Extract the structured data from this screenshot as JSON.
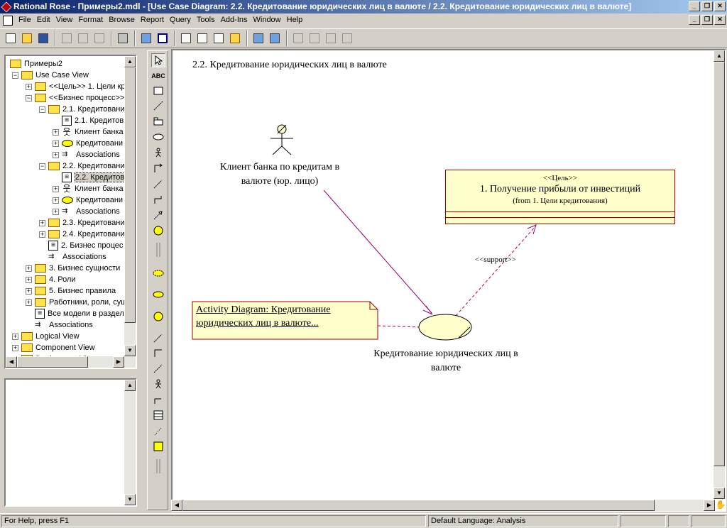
{
  "window": {
    "title": "Rational Rose - Примеры2.mdl - [Use Case Diagram: 2.2. Кредитование юридических лиц в валюте / 2.2. Кредитование юридических лиц в валюте]",
    "minimize": "_",
    "restore": "❐",
    "close": "✕"
  },
  "menu": [
    "File",
    "Edit",
    "View",
    "Format",
    "Browse",
    "Report",
    "Query",
    "Tools",
    "Add-Ins",
    "Window",
    "Help"
  ],
  "toolbar_icons": [
    "new-icon",
    "open-icon",
    "save-icon",
    "cut-icon",
    "copy-icon",
    "paste-icon",
    "print-icon",
    "context-help-icon",
    "view-documentation-icon",
    "browse-class-diagram-icon",
    "browse-interaction-diagram-icon",
    "browse-component-diagram-icon",
    "browse-deployment-diagram-icon",
    "browse-parent-icon",
    "browse-previous-icon",
    "zoom-in-icon",
    "zoom-out-icon",
    "fit-in-window-icon",
    "undo-fit-icon"
  ],
  "browser": {
    "items": [
      {
        "label": "Примеры2",
        "depth": 0,
        "icon": "model",
        "exp": ""
      },
      {
        "label": "Use Case View",
        "depth": 1,
        "icon": "folder",
        "exp": "−"
      },
      {
        "label": "<<Цель>> 1. Цели кр",
        "depth": 2,
        "icon": "folder",
        "exp": "+"
      },
      {
        "label": "<<Бизнес процесс>>",
        "depth": 2,
        "icon": "folder",
        "exp": "−"
      },
      {
        "label": "2.1. Кредитовани",
        "depth": 3,
        "icon": "folder",
        "exp": "−"
      },
      {
        "label": "2.1. Кредитов",
        "depth": 4,
        "icon": "diagram",
        "exp": ""
      },
      {
        "label": "Клиент банка",
        "depth": 4,
        "icon": "actor",
        "exp": "+"
      },
      {
        "label": "Кредитовани",
        "depth": 4,
        "icon": "usecase",
        "exp": "+"
      },
      {
        "label": "Associations",
        "depth": 4,
        "icon": "assoc",
        "exp": "+"
      },
      {
        "label": "2.2. Кредитовани",
        "depth": 3,
        "icon": "folder",
        "exp": "−"
      },
      {
        "label": "2.2. Кредитов",
        "depth": 4,
        "icon": "diagram",
        "exp": "",
        "selected": true
      },
      {
        "label": "Клиент банка",
        "depth": 4,
        "icon": "actor",
        "exp": "+"
      },
      {
        "label": "Кредитовани",
        "depth": 4,
        "icon": "usecase",
        "exp": "+"
      },
      {
        "label": "Associations",
        "depth": 4,
        "icon": "assoc",
        "exp": "+"
      },
      {
        "label": "2.3. Кредитовани",
        "depth": 3,
        "icon": "folder",
        "exp": "+"
      },
      {
        "label": "2.4. Кредитовани",
        "depth": 3,
        "icon": "folder",
        "exp": "+"
      },
      {
        "label": "2. Бизнес процес",
        "depth": 3,
        "icon": "diagram",
        "exp": ""
      },
      {
        "label": "Associations",
        "depth": 3,
        "icon": "assoc",
        "exp": ""
      },
      {
        "label": "3. Бизнес сущности",
        "depth": 2,
        "icon": "folder",
        "exp": "+"
      },
      {
        "label": "4. Роли",
        "depth": 2,
        "icon": "folder",
        "exp": "+"
      },
      {
        "label": "5. Бизнес правила",
        "depth": 2,
        "icon": "folder",
        "exp": "+"
      },
      {
        "label": "Работники, роли, сущ",
        "depth": 2,
        "icon": "folder",
        "exp": "+"
      },
      {
        "label": "Все модели в раздел",
        "depth": 2,
        "icon": "diagram",
        "exp": ""
      },
      {
        "label": "Associations",
        "depth": 2,
        "icon": "assoc",
        "exp": ""
      },
      {
        "label": "Logical View",
        "depth": 1,
        "icon": "folder",
        "exp": "+"
      },
      {
        "label": "Component View",
        "depth": 1,
        "icon": "folder",
        "exp": "+"
      },
      {
        "label": "Deployment View",
        "depth": 1,
        "icon": "folder",
        "exp": "+"
      }
    ]
  },
  "toolbox_tools": [
    "selection-tool",
    "text-box-tool",
    "note-tool",
    "anchor-note-tool",
    "package-tool",
    "use-case-tool",
    "actor-tool",
    "unidirectional-association-tool",
    "dependency-tool",
    "generalization-tool",
    "realize-tool",
    "business-actor-tool",
    "separator",
    "business-use-case-tool",
    "use-case-ellipse-tool",
    "business-worker-tool",
    "dependency-2-tool",
    "association-tool",
    "realize-2-tool",
    "actor-2-tool",
    "generalization-2-tool",
    "class-tool",
    "note-anchor-2-tool",
    "entity-tool",
    "separator"
  ],
  "diagram": {
    "title": "2.2. Кредитование юридических лиц в валюте",
    "actor_label": "Клиент банка по кредитам в валюте (юр. лицо)",
    "use_case_label": "Кредитование юридических лиц в валюте",
    "class": {
      "stereotype": "<<Цель>>",
      "name": "1. Получение прибыли от инвестиций",
      "from": "(from 1. Цели кредитования)"
    },
    "support_label": "<<support>>",
    "note_line1": "Activity Diagram: Кредитование",
    "note_line2": "юридических лиц в валюте..."
  },
  "colors": {
    "note_fill": "#ffffcc",
    "border": "#990000",
    "use_case_fill": "#ffffcc"
  },
  "status": {
    "help": "For Help, press F1",
    "language": "Default Language: Analysis"
  }
}
